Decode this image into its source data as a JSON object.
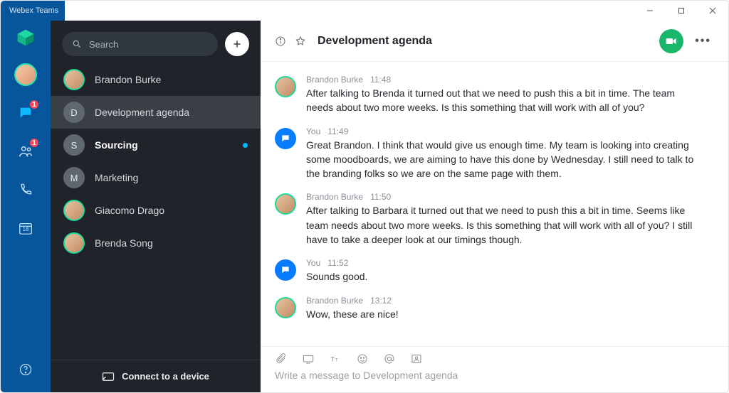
{
  "app_name": "Webex Teams",
  "search": {
    "placeholder": "Search"
  },
  "rail": {
    "badges": {
      "chat": "1",
      "people": "1"
    },
    "calendar_day": "18"
  },
  "spaces": [
    {
      "type": "person",
      "name": "Brandon Burke",
      "active": false,
      "bold": false,
      "unread": false,
      "avatar": "person"
    },
    {
      "type": "letter",
      "name": "Development agenda",
      "active": true,
      "bold": false,
      "unread": false,
      "letter": "D"
    },
    {
      "type": "letter",
      "name": "Sourcing",
      "active": false,
      "bold": true,
      "unread": true,
      "letter": "S"
    },
    {
      "type": "letter",
      "name": "Marketing",
      "active": false,
      "bold": false,
      "unread": false,
      "letter": "M"
    },
    {
      "type": "person",
      "name": "Giacomo Drago",
      "active": false,
      "bold": false,
      "unread": false,
      "avatar": "person"
    },
    {
      "type": "person",
      "name": "Brenda Song",
      "active": false,
      "bold": false,
      "unread": false,
      "avatar": "person"
    }
  ],
  "spaces_footer": "Connect to a device",
  "header": {
    "title": "Development agenda"
  },
  "messages": [
    {
      "who": "Brandon Burke",
      "time": "11:48",
      "self": false,
      "text": "After talking to Brenda it turned out that we need to push this a bit in time. The team needs about two more weeks. Is this something that will work with all of you?"
    },
    {
      "who": "You",
      "time": "11:49",
      "self": true,
      "text": "Great Brandon. I think that would give us enough time. My team is looking into creating some moodboards, we are aiming to have this done by Wednesday. I still need to talk to the branding folks so we are on the same page with them."
    },
    {
      "who": "Brandon Burke",
      "time": "11:50",
      "self": false,
      "text": "After talking to Barbara it turned out that we need to push this a bit in time. Seems like team needs about two more weeks. Is this something that will work with all of you? I still have to take a deeper look at our timings though."
    },
    {
      "who": "You",
      "time": "11:52",
      "self": true,
      "text": "Sounds good."
    },
    {
      "who": "Brandon Burke",
      "time": "13:12",
      "self": false,
      "text": "Wow, these are nice!"
    }
  ],
  "composer": {
    "placeholder": "Write a message to Development agenda"
  }
}
